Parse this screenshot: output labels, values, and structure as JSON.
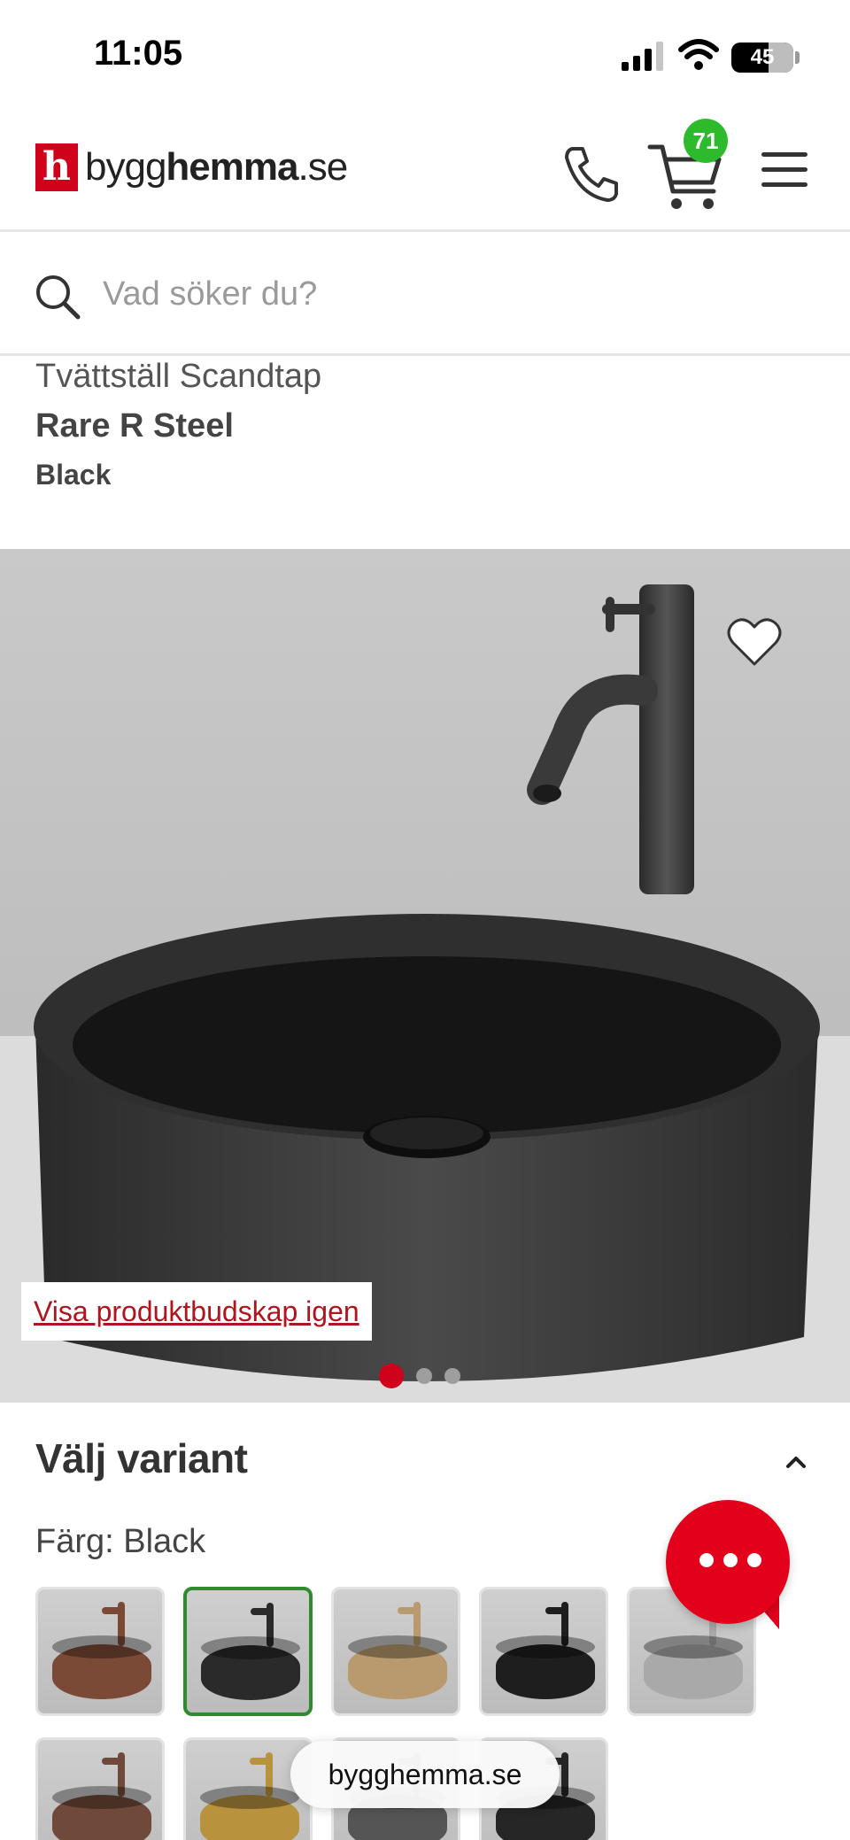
{
  "status_bar": {
    "time": "11:05",
    "battery": "45"
  },
  "header": {
    "logo_mark": "h",
    "logo_name_light": "bygg",
    "logo_name_bold": "hemma",
    "logo_suffix": ".se",
    "cart_count": "71"
  },
  "search": {
    "placeholder": "Vad söker du?"
  },
  "product": {
    "category_brand": "Tvättställ Scandtap",
    "name": "Rare R Steel",
    "variant": "Black"
  },
  "image": {
    "show_message_link": "Visa produktbudskap igen",
    "carousel_total": 3,
    "carousel_active": 1
  },
  "variants": {
    "title": "Välj variant",
    "color_label": "Färg: Black",
    "swatches": [
      {
        "color": "#7a4a36",
        "selected": false
      },
      {
        "color": "#2a2a2a",
        "selected": true
      },
      {
        "color": "#b89a6e",
        "selected": false
      },
      {
        "color": "#1e1e1e",
        "selected": false
      },
      {
        "color": "#a9a9a9",
        "selected": false
      },
      {
        "color": "#6f4a3a",
        "selected": false
      },
      {
        "color": "#b8923c",
        "selected": false
      },
      {
        "color": "#555555",
        "selected": false
      },
      {
        "color": "#262626",
        "selected": false
      }
    ]
  },
  "browser": {
    "url": "bygghemma.se"
  }
}
